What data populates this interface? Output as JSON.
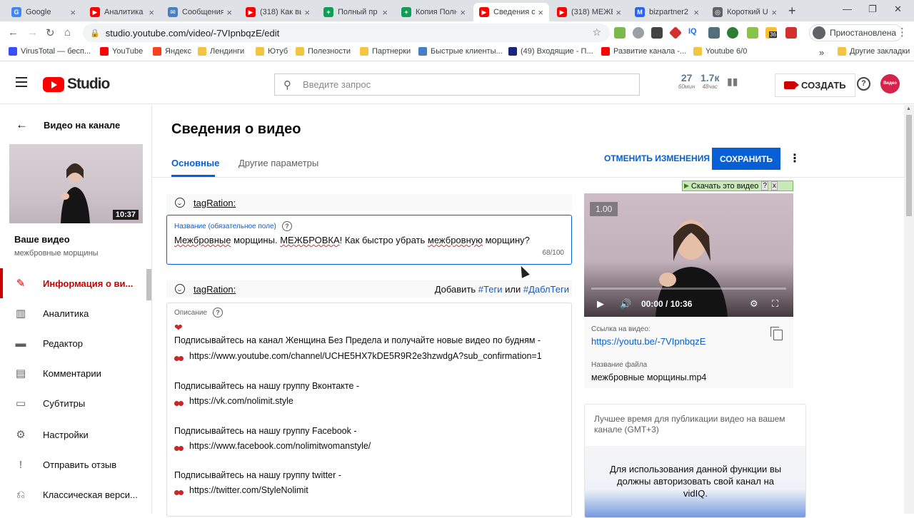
{
  "browser": {
    "tabs": [
      {
        "label": "Google",
        "color": "#4285f4",
        "glyph": "G"
      },
      {
        "label": "Аналитика",
        "color": "#ff0000",
        "glyph": "▶"
      },
      {
        "label": "Сообщения",
        "color": "#4680c2",
        "glyph": "✉"
      },
      {
        "label": "(318) Как вы",
        "color": "#ff0000",
        "glyph": "▶"
      },
      {
        "label": "Полный пр",
        "color": "#0f9d58",
        "glyph": "+"
      },
      {
        "label": "Копия Полн",
        "color": "#0f9d58",
        "glyph": "+"
      },
      {
        "label": "Сведения о",
        "color": "#ff0000",
        "glyph": "▶"
      },
      {
        "label": "(318) МЕЖБ",
        "color": "#ff0000",
        "glyph": "▶"
      },
      {
        "label": "bizpartner2",
        "color": "#2962ff",
        "glyph": "M"
      },
      {
        "label": "Короткий U",
        "color": "#5f6368",
        "glyph": "◎"
      }
    ],
    "active_tab_index": 6,
    "new_tab_glyph": "+",
    "url": "studio.youtube.com/video/-7VIpnbqzE/edit",
    "profile_status": "Приостановлена",
    "badge_count": "36",
    "bookmarks": [
      {
        "label": "VirusTotal — бесп...",
        "icon": "virustotal-icon"
      },
      {
        "label": "YouTube",
        "icon": "youtube-icon"
      },
      {
        "label": "Яндекс",
        "icon": "yandex-icon"
      },
      {
        "label": "Лендинги",
        "icon": "folder-icon"
      },
      {
        "label": "Ютуб",
        "icon": "folder-icon"
      },
      {
        "label": "Полезности",
        "icon": "folder-icon"
      },
      {
        "label": "Партнерки",
        "icon": "folder-icon"
      },
      {
        "label": "Быстрые клиенты...",
        "icon": "vk-icon"
      },
      {
        "label": "(49) Входящие - П...",
        "icon": "mail-icon"
      },
      {
        "label": "Развитие канала -...",
        "icon": "youtube-icon"
      },
      {
        "label": "Youtube 6/0",
        "icon": "folder-icon"
      }
    ],
    "bookmarks_overflow": "»",
    "other_bookmarks": "Другие закладки"
  },
  "header": {
    "logo_text": "Studio",
    "search_placeholder": "Введите запрос",
    "stat1_value": "27",
    "stat1_label": "60мин",
    "stat2_value": "1.7к",
    "stat2_label": "48час",
    "create_label": "СОЗДАТЬ",
    "channel_avatar_text": "Видео Жизни"
  },
  "sidebar": {
    "back_label": "Видео на канале",
    "thumb_duration": "10:37",
    "video_heading": "Ваше видео",
    "video_subtitle": "межбровные морщины",
    "items": [
      {
        "label": "Информация о ви...",
        "icon": "pencil-icon",
        "active": true
      },
      {
        "label": "Аналитика",
        "icon": "analytics-icon",
        "active": false
      },
      {
        "label": "Редактор",
        "icon": "editor-icon",
        "active": false
      },
      {
        "label": "Комментарии",
        "icon": "comments-icon",
        "active": false
      },
      {
        "label": "Субтитры",
        "icon": "subtitles-icon",
        "active": false
      },
      {
        "label": "Настройки",
        "icon": "gear-icon",
        "active": false
      },
      {
        "label": "Отправить отзыв",
        "icon": "feedback-icon",
        "active": false
      },
      {
        "label": "Классическая верси...",
        "icon": "classic-icon",
        "active": false
      }
    ]
  },
  "main": {
    "page_title": "Сведения о видео",
    "tabs": [
      {
        "label": "Основные",
        "selected": true
      },
      {
        "label": "Другие параметры",
        "selected": false
      }
    ],
    "discard_label": "ОТМЕНИТЬ ИЗМЕНЕНИЯ",
    "save_label": "СОХРАНИТЬ",
    "ext_name": "tagRation:",
    "add_tags_prefix": "Добавить",
    "add_tags_link1": "#Теги",
    "add_tags_or": "или",
    "add_tags_link2": "#ДаблТеги",
    "title_field": {
      "label": "Название (обязательное поле)",
      "value_parts": [
        "Межбровные",
        " морщины. ",
        "МЕЖБРОВКА",
        "! Как быстро убрать ",
        "межбровную",
        " морщину?"
      ],
      "counter": "68/100"
    },
    "description": {
      "label": "Описание",
      "lines": [
        {
          "text": "Подписывайтесь на канал Женщина Без Предела и получайте новые видео по будням -",
          "icon": ""
        },
        {
          "text": "https://www.youtube.com/channel/UCHE5HX7kDE5R9R2e3hzwdgA?sub_confirmation=1",
          "icon": "cherry"
        },
        {
          "text": "Подписывайтесь на нашу группу Вконтакте -",
          "icon": ""
        },
        {
          "text": "https://vk.com/nolimit.style",
          "icon": "cherry"
        },
        {
          "text": "Подписывайтесь на нашу группу Facebook -",
          "icon": ""
        },
        {
          "text": "https://www.facebook.com/nolimitwomanstyle/",
          "icon": "cherry"
        },
        {
          "text": "Подписывайтесь на нашу группу twitter -",
          "icon": ""
        },
        {
          "text": "https://twitter.com/StyleNolimit",
          "icon": "cherry"
        }
      ]
    }
  },
  "right": {
    "download_label": "Скачать это видео",
    "download_help": "?",
    "download_close": "x",
    "player_speed": "1.00",
    "player_time": "00:00 / 10:36",
    "link_label": "Ссылка на видео:",
    "link_value": "https://youtu.be/-7VIpnbqzE",
    "file_label": "Название файла",
    "file_value": "межбровные морщины.mp4",
    "best_time_title": "Лучшее время для публикации видео на вашем канале (GMT+3)",
    "best_time_msg": "Для использования данной функции вы должны авторизовать свой канал на vidIQ."
  },
  "colors": {
    "accent_blue": "#065fd4",
    "brand_red": "#cc0000",
    "yt_red": "#ff0000"
  }
}
